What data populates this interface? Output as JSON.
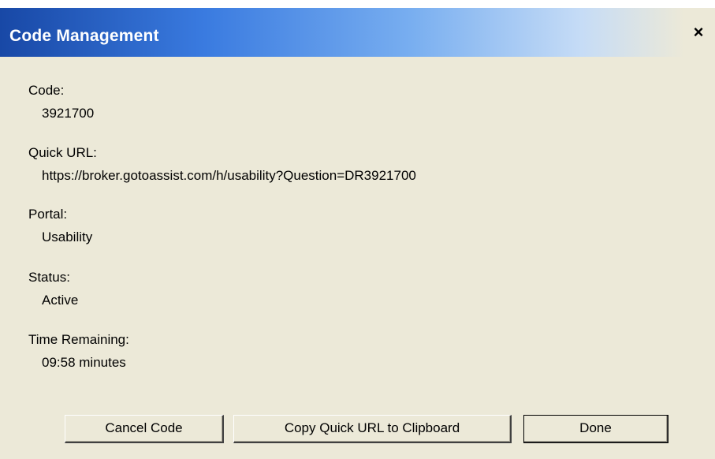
{
  "window": {
    "title": "Code Management",
    "close_label": "×"
  },
  "fields": {
    "code": {
      "label": "Code:",
      "value": "3921700"
    },
    "quick_url": {
      "label": "Quick URL:",
      "value": "https://broker.gotoassist.com/h/usability?Question=DR3921700"
    },
    "portal": {
      "label": "Portal:",
      "value": "Usability"
    },
    "status": {
      "label": "Status:",
      "value": "Active"
    },
    "time_remaining": {
      "label": "Time Remaining:",
      "value": "09:58 minutes"
    }
  },
  "buttons": {
    "cancel_code": "Cancel Code",
    "copy_url": "Copy Quick URL to Clipboard",
    "done": "Done"
  },
  "colors": {
    "title_bar_start": "#1848a6",
    "title_bar_end": "#ece9d8",
    "dialog_background": "#ece9d8"
  }
}
